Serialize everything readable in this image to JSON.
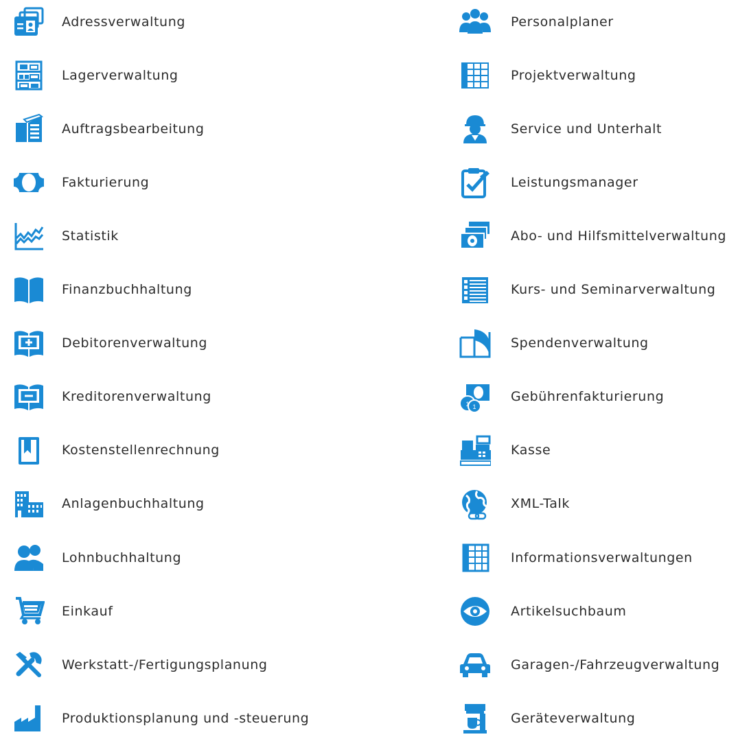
{
  "accent_color": "#1a8ad4",
  "left_column": [
    {
      "label": "Adressverwaltung",
      "icon": "address-card-icon"
    },
    {
      "label": "Lagerverwaltung",
      "icon": "warehouse-shelf-icon"
    },
    {
      "label": "Auftragsbearbeitung",
      "icon": "document-stack-icon"
    },
    {
      "label": "Fakturierung",
      "icon": "banknote-icon"
    },
    {
      "label": "Statistik",
      "icon": "line-chart-icon"
    },
    {
      "label": "Finanzbuchhaltung",
      "icon": "open-book-icon"
    },
    {
      "label": "Debitorenverwaltung",
      "icon": "book-plus-icon"
    },
    {
      "label": "Kreditorenverwaltung",
      "icon": "book-minus-icon"
    },
    {
      "label": "Kostenstellenrechnung",
      "icon": "bookmark-book-icon"
    },
    {
      "label": "Anlagenbuchhaltung",
      "icon": "buildings-icon"
    },
    {
      "label": "Lohnbuchhaltung",
      "icon": "people-icon"
    },
    {
      "label": "Einkauf",
      "icon": "shopping-cart-icon"
    },
    {
      "label": "Werkstatt-/Fertigungsplanung",
      "icon": "tools-icon"
    },
    {
      "label": "Produktionsplanung und -steuerung",
      "icon": "factory-icon"
    }
  ],
  "right_column": [
    {
      "label": "Personalplaner",
      "icon": "team-icon"
    },
    {
      "label": "Projektverwaltung",
      "icon": "grid-table-icon"
    },
    {
      "label": "Service und Unterhalt",
      "icon": "worker-helmet-icon"
    },
    {
      "label": "Leistungsmanager",
      "icon": "clipboard-check-icon"
    },
    {
      "label": "Abo- und Hilfsmittelverwaltung",
      "icon": "banknote-stack-icon"
    },
    {
      "label": "Kurs- und Seminarverwaltung",
      "icon": "list-table-icon"
    },
    {
      "label": "Spendenverwaltung",
      "icon": "donation-box-icon"
    },
    {
      "label": "Gebührenfakturierung",
      "icon": "coins-banknote-icon"
    },
    {
      "label": "Kasse",
      "icon": "cash-register-icon"
    },
    {
      "label": "XML-Talk",
      "icon": "globe-link-icon"
    },
    {
      "label": "Informationsverwaltungen",
      "icon": "info-table-icon"
    },
    {
      "label": "Artikelsuchbaum",
      "icon": "eye-icon"
    },
    {
      "label": "Garagen-/Fahrzeugverwaltung",
      "icon": "car-icon"
    },
    {
      "label": "Geräteverwaltung",
      "icon": "coffee-machine-icon"
    }
  ]
}
